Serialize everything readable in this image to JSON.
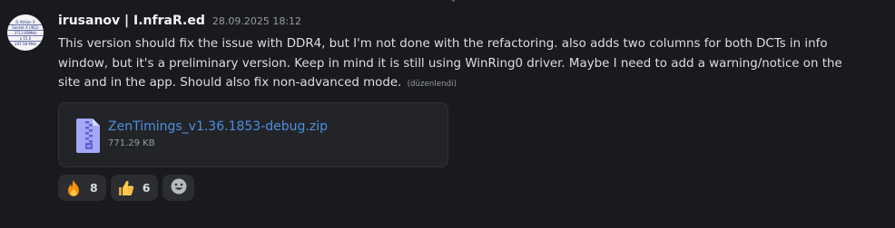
{
  "author": {
    "username": "irusanov | I.nfraR.ed",
    "timestamp": "28.09.2025 18:12",
    "avatar_lines": [
      "D Athlon X",
      "Socket A (462)",
      "3713.69MHz",
      "x 15.0",
      "247.58 MHz"
    ]
  },
  "message": {
    "text": "This version should fix the issue with DDR4, but I'm not done with the refactoring. also adds two columns for both DCTs in info window, but it's a preliminary version. Keep in mind it is still using WinRing0 driver. Maybe I need to add a warning/notice on the site and in the app. Should also fix non-advanced mode.",
    "edited_label": "(düzenlendi)"
  },
  "attachment": {
    "file_name": "ZenTimings_v1.36.1853-debug.zip",
    "file_size": "771.29 KB",
    "icon": "zip-file-icon"
  },
  "reactions": [
    {
      "emoji": "fire-emoji",
      "count": "8"
    },
    {
      "emoji": "thumbs-up-emoji",
      "count": "6"
    }
  ],
  "add_reaction_icon": "smiley-icon",
  "colors": {
    "background": "#1a1a1e",
    "username": "#f2f3f5",
    "body_text": "#dbdee1",
    "muted": "#949ba4",
    "link": "#4c8fe0",
    "attachment_bg": "#232428",
    "reaction_bg": "#2b2d31"
  }
}
